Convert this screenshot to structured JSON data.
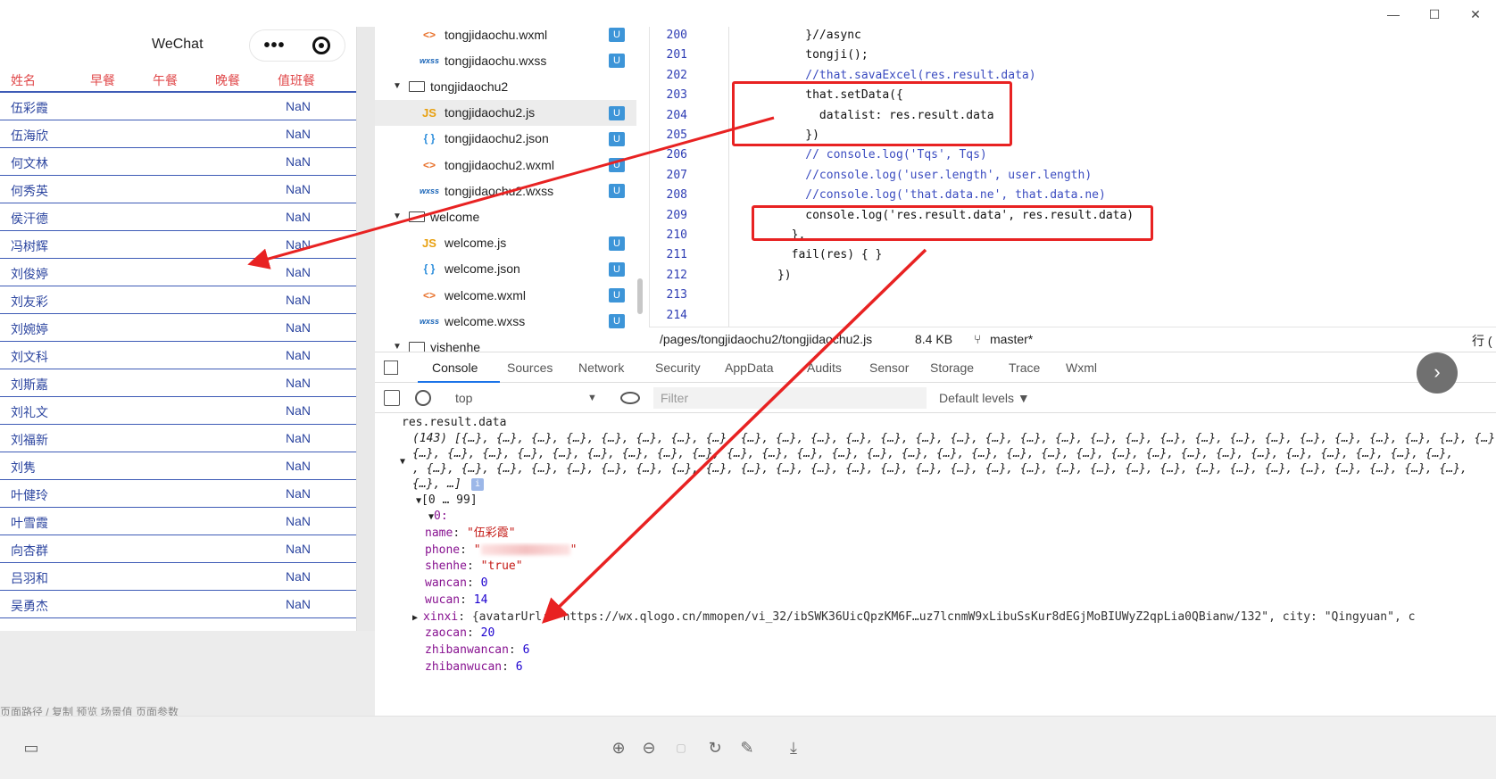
{
  "window": {
    "minimize": "—",
    "maximize": "☐",
    "close": "✕"
  },
  "simulator": {
    "title": "WeChat",
    "capsule_dots": "•••",
    "headers": [
      "姓名",
      "早餐",
      "午餐",
      "晚餐",
      "值班餐"
    ],
    "rows": [
      {
        "name": "伍彩霞",
        "value": "NaN"
      },
      {
        "name": "伍海欣",
        "value": "NaN"
      },
      {
        "name": "何文林",
        "value": "NaN"
      },
      {
        "name": "何秀英",
        "value": "NaN"
      },
      {
        "name": "侯汗德",
        "value": "NaN"
      },
      {
        "name": "冯树辉",
        "value": "NaN"
      },
      {
        "name": "刘俊婷",
        "value": "NaN"
      },
      {
        "name": "刘友彩",
        "value": "NaN"
      },
      {
        "name": "刘婉婷",
        "value": "NaN"
      },
      {
        "name": "刘文科",
        "value": "NaN"
      },
      {
        "name": "刘斯嘉",
        "value": "NaN"
      },
      {
        "name": "刘礼文",
        "value": "NaN"
      },
      {
        "name": "刘福新",
        "value": "NaN"
      },
      {
        "name": "刘隽",
        "value": "NaN"
      },
      {
        "name": "叶健玲",
        "value": "NaN"
      },
      {
        "name": "叶雪霞",
        "value": "NaN"
      },
      {
        "name": "向杏群",
        "value": "NaN"
      },
      {
        "name": "吕羽和",
        "value": "NaN"
      },
      {
        "name": "吴勇杰",
        "value": "NaN"
      }
    ],
    "footer": "页面路径    /     复制  预览    场景值    页面参数"
  },
  "file_tree": {
    "items": [
      {
        "type": "wxml",
        "icon": "<>",
        "label": "tongjidaochu.wxml",
        "badge": "U"
      },
      {
        "type": "wxss",
        "icon": "wxss",
        "label": "tongjidaochu.wxss",
        "badge": "U"
      },
      {
        "type": "folder",
        "icon": "",
        "label": "tongjidaochu2",
        "badge": ""
      },
      {
        "type": "js",
        "icon": "JS",
        "label": "tongjidaochu2.js",
        "badge": "U"
      },
      {
        "type": "json",
        "icon": "{ }",
        "label": "tongjidaochu2.json",
        "badge": "U"
      },
      {
        "type": "wxml",
        "icon": "<>",
        "label": "tongjidaochu2.wxml",
        "badge": "U"
      },
      {
        "type": "wxss",
        "icon": "wxss",
        "label": "tongjidaochu2.wxss",
        "badge": "U"
      },
      {
        "type": "folder",
        "icon": "",
        "label": "welcome",
        "badge": ""
      },
      {
        "type": "js",
        "icon": "JS",
        "label": "welcome.js",
        "badge": "U"
      },
      {
        "type": "json",
        "icon": "{ }",
        "label": "welcome.json",
        "badge": "U"
      },
      {
        "type": "wxml",
        "icon": "<>",
        "label": "welcome.wxml",
        "badge": "U"
      },
      {
        "type": "wxss",
        "icon": "wxss",
        "label": "welcome.wxss",
        "badge": "U"
      },
      {
        "type": "folder",
        "icon": "",
        "label": "yishenhe",
        "badge": ""
      }
    ]
  },
  "editor": {
    "lines": [
      {
        "num": "200",
        "text": "          }//async"
      },
      {
        "num": "201",
        "text": "          tongji();"
      },
      {
        "num": "202",
        "text": "          //that.savaExcel(res.result.data)"
      },
      {
        "num": "203",
        "text": "          that.setData({"
      },
      {
        "num": "204",
        "text": "            datalist: res.result.data"
      },
      {
        "num": "205",
        "text": "          })"
      },
      {
        "num": "206",
        "text": "          // console.log('Tqs', Tqs)"
      },
      {
        "num": "207",
        "text": "          //console.log('user.length', user.length)"
      },
      {
        "num": "208",
        "text": "          //console.log('that.data.ne', that.data.ne)"
      },
      {
        "num": "209",
        "text": "          console.log('res.result.data', res.result.data)"
      },
      {
        "num": "210",
        "text": "        },"
      },
      {
        "num": "211",
        "text": "        fail(res) { }"
      },
      {
        "num": "212",
        "text": "      })"
      },
      {
        "num": "213",
        "text": ""
      },
      {
        "num": "214",
        "text": ""
      }
    ],
    "status": {
      "path": "/pages/tongjidaochu2/tongjidaochu2.js",
      "size": "8.4 KB",
      "branch": "master*",
      "line_label": "行 ("
    }
  },
  "devtools": {
    "tabs": [
      "Console",
      "Sources",
      "Network",
      "Security",
      "AppData",
      "Audits",
      "Sensor",
      "Storage",
      "Trace",
      "Wxml"
    ],
    "active_tab": "Console",
    "context": "top",
    "filter_placeholder": "Filter",
    "levels": "Default levels ▼"
  },
  "console": {
    "label": "res.result.data",
    "array_summary": "(143) [{…}, {…}, {…}, {…}, {…}, {…}, {…}, {…}, {…}, {…}, {…}, {…}, {…}, {…}, {…}, {…}, {…}, {…}, {…}, {…}, {…}, {…}, {…}, {…}, {…}, {…}, {…}, {…}, {…}, {…},",
    "array_line2": "{…}, {…}, {…}, {…}, {…}, {…}, {…}, {…}, {…}, {…}, {…}, {…}, {…}, {…}, {…}, {…}, {…}, {…}, {…}, {…}, {…}, {…}, {…}, {…}, {…}, {…}, {…}, {…}, {…}, {…},",
    "array_line3": ", {…}, {…}, {…}, {…}, {…}, {…}, {…}, {…}, {…}, {…}, {…}, {…}, {…}, {…}, {…}, {…}, {…}, {…}, {…}, {…}, {…}, {…}, {…}, {…}, {…}, {…}, {…}, {…}, {…}, {…},",
    "array_line4": "{…}, …]",
    "range": "[0 … 99]",
    "index": "0:",
    "fields": [
      {
        "key": "name",
        "value": "\"伍彩霞\"",
        "kind": "str"
      },
      {
        "key": "phone",
        "value": "\"",
        "kind": "str"
      },
      {
        "key": "shenhe",
        "value": "\"true\"",
        "kind": "str"
      },
      {
        "key": "wancan",
        "value": "0",
        "kind": "num"
      },
      {
        "key": "wucan",
        "value": "14",
        "kind": "num"
      },
      {
        "key": "xinxi",
        "value": "{avatarUrl: \"https://wx.qlogo.cn/mmopen/vi_32/ibSWK36UicQpzKM6F…uz7lcnmW9xLibuSsKur8dEGjMoBIUWyZ2qpLia0QBianw/132\", city: \"Qingyuan\", c",
        "kind": "obj"
      },
      {
        "key": "zaocan",
        "value": "20",
        "kind": "num"
      },
      {
        "key": "zhibanwancan",
        "value": "6",
        "kind": "num"
      },
      {
        "key": "zhibanwucan",
        "value": "6",
        "kind": "num"
      }
    ]
  },
  "bottom_bar": {
    "icons": [
      "layout-icon",
      "zoom-in-icon",
      "zoom-out-icon",
      "fit-icon",
      "rotate-icon",
      "edit-icon",
      "download-icon"
    ]
  },
  "colors": {
    "annotation": "#e82222",
    "table_line": "#3e5bb6",
    "header_text": "#e0484a",
    "badge": "#3d95d8"
  }
}
